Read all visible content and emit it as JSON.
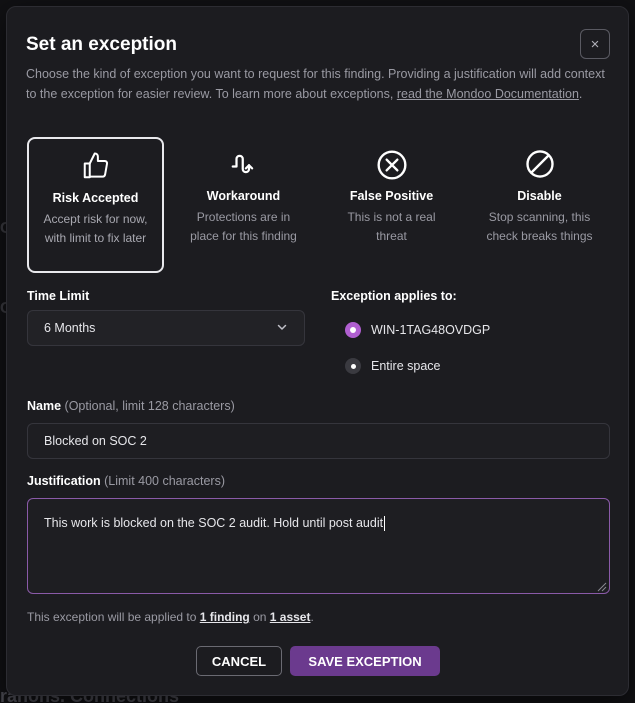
{
  "backdrop": {
    "fragment_1": "C",
    "fragment_2": "C",
    "fragment_3": "ranons. Connections"
  },
  "dialog": {
    "title": "Set an exception",
    "close_icon": "×",
    "description_pre": "Choose the kind of exception you want to request for this finding. Providing a justification will add context to the exception for easier review. To learn more about exceptions, ",
    "description_link": "read the Mondoo Documentation",
    "description_post": ".",
    "options": [
      {
        "icon": "thumbs-up-icon",
        "label": "Risk Accepted",
        "desc": "Accept risk for now, with limit to fix later",
        "selected": true
      },
      {
        "icon": "workaround-icon",
        "label": "Workaround",
        "desc": "Protections are in place for this finding",
        "selected": false
      },
      {
        "icon": "circle-x-icon",
        "label": "False Positive",
        "desc": "This is not a real threat",
        "selected": false
      },
      {
        "icon": "disable-icon",
        "label": "Disable",
        "desc": "Stop scanning, this check breaks things",
        "selected": false
      }
    ],
    "time_limit": {
      "label": "Time Limit",
      "value": "6 Months"
    },
    "applies_to": {
      "label": "Exception applies to:",
      "options": [
        {
          "label": "WIN-1TAG48OVDGP",
          "selected": true
        },
        {
          "label": "Entire space",
          "selected": false
        }
      ]
    },
    "name": {
      "label": "Name",
      "hint": "(Optional, limit 128 characters)",
      "value": "Blocked on SOC 2"
    },
    "justification": {
      "label": "Justification",
      "hint": "(Limit 400 characters)",
      "value": "This work is blocked on the SOC 2 audit. Hold until post audit"
    },
    "footnote": {
      "pre": "This exception will be applied to ",
      "findings": "1 finding",
      "mid": " on ",
      "assets": "1 asset",
      "post": "."
    },
    "buttons": {
      "cancel": "CANCEL",
      "save": "SAVE EXCEPTION"
    },
    "colors": {
      "accent": "#6b3a8e",
      "radio_on": "#b05fd0",
      "focus_border": "#8a5aa8"
    }
  }
}
